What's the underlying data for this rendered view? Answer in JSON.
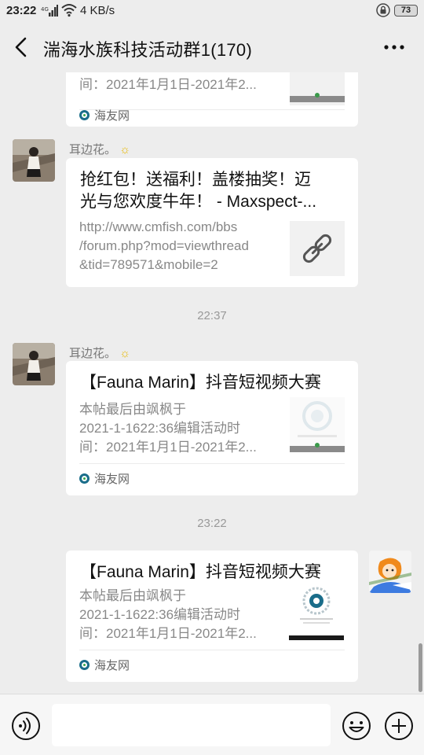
{
  "status_bar": {
    "time": "23:22",
    "signal": "4G",
    "speed": "4 KB/s",
    "battery": "73"
  },
  "header": {
    "title": "湍海水族科技活动群1(170)"
  },
  "messages": [
    {
      "desc_lines": [
        "间：2021年1月1日-2021年2..."
      ],
      "source": "海友网"
    },
    {
      "sender": "耳边花。",
      "sun": "☼",
      "title_lines": [
        "抢红包！送福利！盖楼抽奖！迈",
        "光与您欢度牛年！ - Maxspect-..."
      ],
      "desc_lines": [
        "http://www.cmfish.com/bbs",
        "/forum.php?mod=viewthread",
        "&tid=789571&mobile=2"
      ]
    },
    {
      "timestamp": "22:37"
    },
    {
      "sender": "耳边花。",
      "sun": "☼",
      "title": "【Fauna Marin】抖音短视频大赛",
      "desc_lines": [
        "本帖最后由飒枫于",
        "2021-1-1622:36编辑活动时",
        "间：2021年1月1日-2021年2..."
      ],
      "source": "海友网"
    },
    {
      "timestamp": "23:22"
    },
    {
      "title": "【Fauna Marin】抖音短视频大赛",
      "desc_lines": [
        "本帖最后由飒枫于",
        "2021-1-1622:36编辑活动时",
        "间：2021年1月1日-2021年2..."
      ],
      "source": "海友网"
    }
  ],
  "colors": {
    "background": "#ededed",
    "card": "#ffffff",
    "source_icon": "#1a6d8a"
  }
}
